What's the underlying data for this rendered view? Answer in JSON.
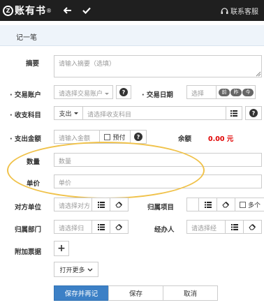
{
  "app": {
    "logo_mark": "Z",
    "name": "账有书",
    "reg": "®",
    "support_label": "联系客服",
    "back_icon": "arrow-left-icon",
    "confirm_icon": "check-icon",
    "support_icon": "headset-icon"
  },
  "page": {
    "title": "记一笔"
  },
  "form": {
    "summary": {
      "label": "摘要",
      "placeholder": "请输入摘要（选填）"
    },
    "account": {
      "label": "· 交易账户",
      "placeholder": "请选择交易账户",
      "help": "?"
    },
    "date": {
      "label": "· 交易日期",
      "placeholder": "选择",
      "pills": [
        "前",
        "昨",
        "今"
      ]
    },
    "category": {
      "label": "· 收支科目",
      "type": "支出",
      "placeholder": "请选择收支科目"
    },
    "amount": {
      "label": "· 支出金额",
      "placeholder": "请输入金额",
      "prepaid": "预付",
      "help": "?",
      "balance_label": "余额",
      "balance_value": "0.00 元"
    },
    "quantity": {
      "label": "数量",
      "placeholder": "数量"
    },
    "unit_price": {
      "label": "单价",
      "placeholder": "单价"
    },
    "counterparty": {
      "label": "对方单位",
      "placeholder": "请选择对方"
    },
    "project": {
      "label": "归属项目",
      "multi": "多个"
    },
    "department": {
      "label": "归属部门",
      "placeholder": "请选择归"
    },
    "handler": {
      "label": "经办人",
      "placeholder": "请选择经"
    },
    "attachment": {
      "label": "附加票据",
      "add": "+"
    },
    "more": "打开更多"
  },
  "actions": {
    "save_again": "保存并再记",
    "save": "保存",
    "cancel": "取消"
  },
  "colors": {
    "primary": "#3c80c6",
    "topbar": "#1f1f1f",
    "title_bg": "#eef4fa",
    "highlight_oval": "#f0c24a",
    "balance": "#e00000"
  }
}
